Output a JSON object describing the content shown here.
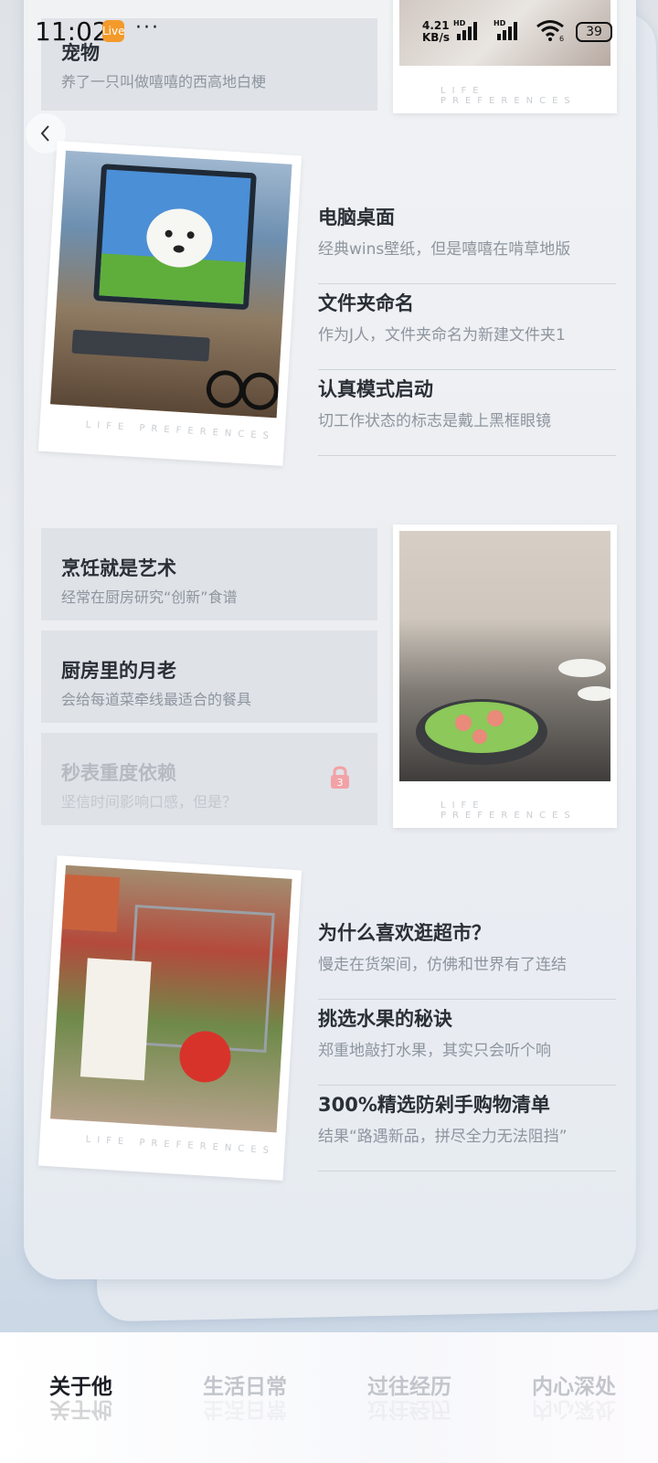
{
  "status_bar": {
    "time": "11:02",
    "app_badge": "Live",
    "more": "···",
    "net_speed_value": "4.21",
    "net_speed_unit": "KB/s",
    "sig1_label": "HD",
    "sig2_label": "HD",
    "wifi_sub": "6",
    "battery": "39"
  },
  "caption": "LIFE PREFERENCES",
  "top_card": {
    "title": "宠物",
    "subtitle": "养了一只叫做嘻嘻的西高地白梗"
  },
  "section1": {
    "items": [
      {
        "title": "电脑桌面",
        "subtitle": "经典wins壁纸，但是嘻嘻在啃草地版"
      },
      {
        "title": "文件夹命名",
        "subtitle": "作为J人，文件夹命名为新建文件夹1"
      },
      {
        "title": "认真模式启动",
        "subtitle": "切工作状态的标志是戴上黑框眼镜"
      }
    ]
  },
  "section2": {
    "cards": [
      {
        "title": "烹饪就是艺术",
        "subtitle": "经常在厨房研究“创新”食谱"
      },
      {
        "title": "厨房里的月老",
        "subtitle": "会给每道菜牵线最适合的餐具"
      },
      {
        "title": "秒表重度依赖",
        "subtitle": "坚信时间影响口感，但是？",
        "locked": true,
        "lock_number": "3"
      }
    ]
  },
  "section3": {
    "items": [
      {
        "title": "为什么喜欢逛超市？",
        "subtitle": "慢走在货架间，仿佛和世界有了连结"
      },
      {
        "title": "挑选水果的秘诀",
        "subtitle": "郑重地敲打水果，其实只会听个响"
      },
      {
        "title": "300%精选防剁手购物清单",
        "subtitle": "结果“路遇新品，拼尽全力无法阻挡”"
      }
    ]
  },
  "tabs": [
    {
      "label": "关于他",
      "active": true
    },
    {
      "label": "生活日常",
      "active": false
    },
    {
      "label": "过往经历",
      "active": false
    },
    {
      "label": "内心深处",
      "active": false
    }
  ],
  "colors": {
    "accent_lock": "#f2a2a6",
    "title_text": "#2a2f36",
    "sub_text": "#8e959e"
  }
}
